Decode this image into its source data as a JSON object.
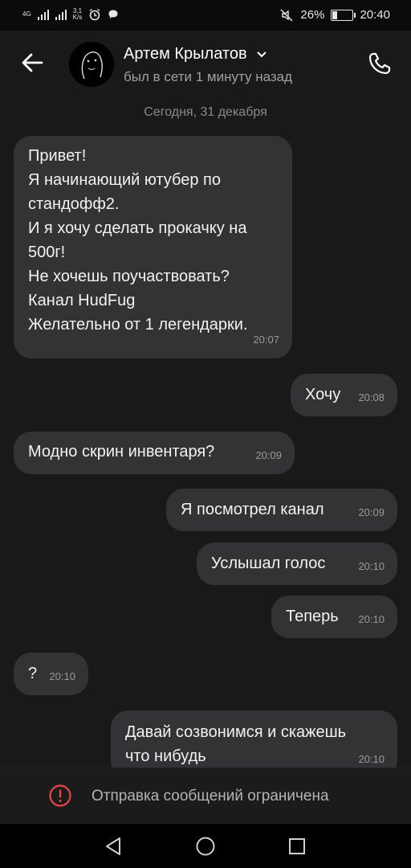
{
  "status_bar": {
    "network_type": "4G",
    "speed_value": "3,1",
    "speed_unit": "K/s",
    "battery_percent": "26%",
    "battery_level": 0.26,
    "time": "20:40"
  },
  "header": {
    "contact_name": "Артем Крылатов",
    "presence": "был в сети 1 минуту назад"
  },
  "date_separator": "Сегодня, 31 декабря",
  "messages": [
    {
      "direction": "incoming",
      "text": "Привет!\nЯ начинающий ютубер по\nстандофф2.\nИ я хочу сделать прокачку на\n500г!\nНе хочешь поучаствовать?\nКанал HudFug\nЖелательно от 1 легендарки.",
      "time": "20:07"
    },
    {
      "direction": "outgoing",
      "text": "Хочу",
      "time": "20:08"
    },
    {
      "direction": "incoming",
      "text": "Модно скрин инвентаря?",
      "time": "20:09"
    },
    {
      "direction": "outgoing",
      "text": "Я посмотрел канал",
      "time": "20:09"
    },
    {
      "direction": "outgoing",
      "text": "Услышал голос",
      "time": "20:10"
    },
    {
      "direction": "outgoing",
      "text": "Теперь",
      "time": "20:10"
    },
    {
      "direction": "incoming",
      "text": "?",
      "time": "20:10"
    },
    {
      "direction": "outgoing",
      "text": "Давай созвонимся и скажешь\nчто нибудь",
      "time": "20:10"
    }
  ],
  "composer": {
    "restriction_text": "Отправка сообщений ограничена"
  },
  "colors": {
    "background": "#191919",
    "bubble": "#333335",
    "warning": "#e64646"
  }
}
